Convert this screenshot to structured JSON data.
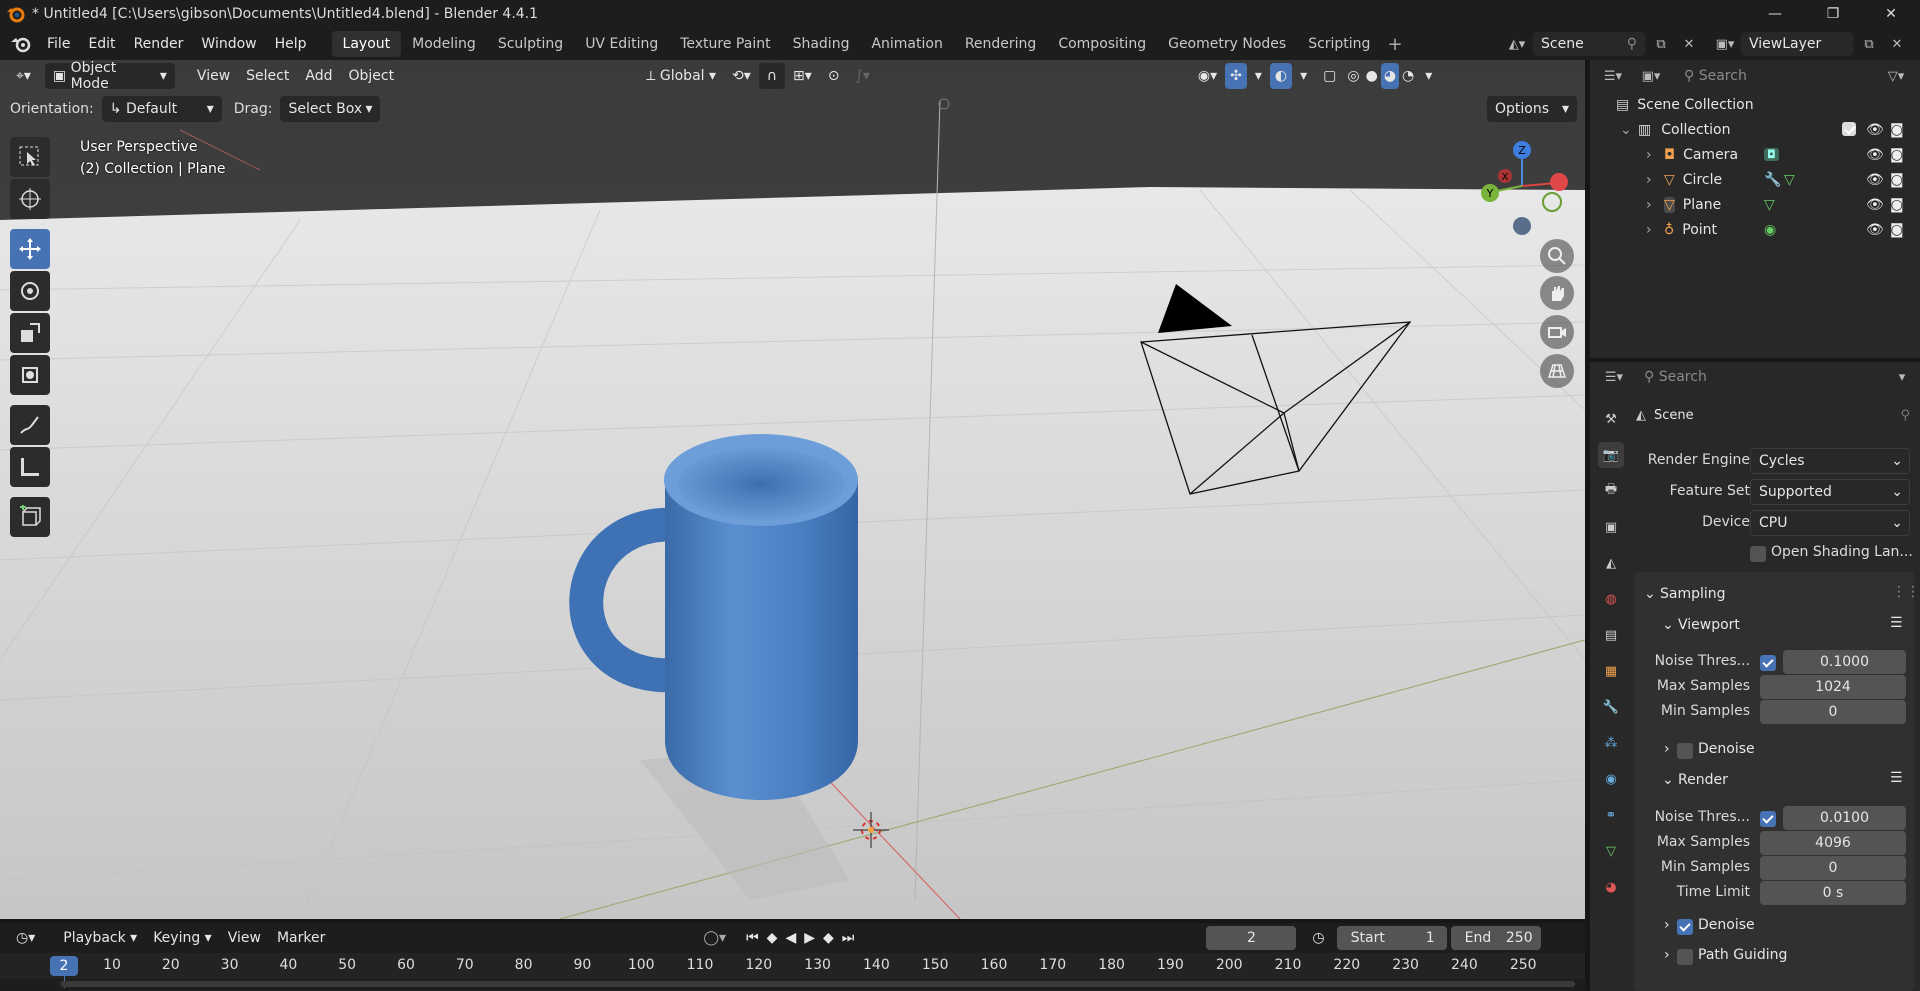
{
  "window": {
    "title": "* Untitled4 [C:\\Users\\gibson\\Documents\\Untitled4.blend] - Blender 4.4.1",
    "minimize": "—",
    "maximize": "❐",
    "close": "✕"
  },
  "menu": [
    "File",
    "Edit",
    "Render",
    "Window",
    "Help"
  ],
  "workspaces": [
    "Layout",
    "Modeling",
    "Sculpting",
    "UV Editing",
    "Texture Paint",
    "Shading",
    "Animation",
    "Rendering",
    "Compositing",
    "Geometry Nodes",
    "Scripting"
  ],
  "active_workspace": "Layout",
  "scene": {
    "name": "Scene",
    "view_layer": "ViewLayer"
  },
  "viewport": {
    "mode": "Object Mode",
    "menus": [
      "View",
      "Select",
      "Add",
      "Object"
    ],
    "transform_orientation": "Global",
    "orientation_label": "Orientation:",
    "orientation_value": "Default",
    "drag_label": "Drag:",
    "drag_value": "Select Box",
    "options": "Options",
    "overlay_line1": "User Perspective",
    "overlay_line2": "(2) Collection | Plane",
    "gizmo": {
      "x": "X",
      "y": "Y",
      "z": "Z"
    }
  },
  "outliner": {
    "search_placeholder": "Search",
    "root": "Scene Collection",
    "collection": "Collection",
    "items": [
      "Camera",
      "Circle",
      "Plane",
      "Point"
    ]
  },
  "properties": {
    "search_placeholder": "Search",
    "context": "Scene",
    "render_engine_label": "Render Engine",
    "render_engine": "Cycles",
    "feature_set_label": "Feature Set",
    "feature_set": "Supported",
    "device_label": "Device",
    "device": "CPU",
    "open_shading": "Open Shading Lan...",
    "sampling": "Sampling",
    "viewport_panel": "Viewport",
    "render_panel": "Render",
    "viewport_noise_label": "Noise Thres...",
    "viewport_noise": "0.1000",
    "viewport_max_label": "Max Samples",
    "viewport_max": "1024",
    "viewport_min_label": "Min Samples",
    "viewport_min": "0",
    "denoise": "Denoise",
    "render_noise_label": "Noise Thres...",
    "render_noise": "0.0100",
    "render_max_label": "Max Samples",
    "render_max": "4096",
    "render_min_label": "Min Samples",
    "render_min": "0",
    "time_limit_label": "Time Limit",
    "time_limit": "0 s",
    "render_denoise": "Denoise",
    "path_guiding": "Path Guiding"
  },
  "timeline": {
    "menus": [
      "Playback",
      "Keying",
      "View",
      "Marker"
    ],
    "current_frame": "2",
    "start_label": "Start",
    "start": "1",
    "end_label": "End",
    "end": "250",
    "ruler_current": "2",
    "ruler_ticks": [
      "10",
      "20",
      "30",
      "40",
      "50",
      "60",
      "70",
      "80",
      "90",
      "100",
      "110",
      "120",
      "130",
      "140",
      "150",
      "160",
      "170",
      "180",
      "190",
      "200",
      "210",
      "220",
      "230",
      "240",
      "250"
    ]
  },
  "colors": {
    "accent": "#4772b3",
    "mug": "#4a7fc1",
    "floor": "#d2d2d2",
    "panel": "#282828"
  }
}
